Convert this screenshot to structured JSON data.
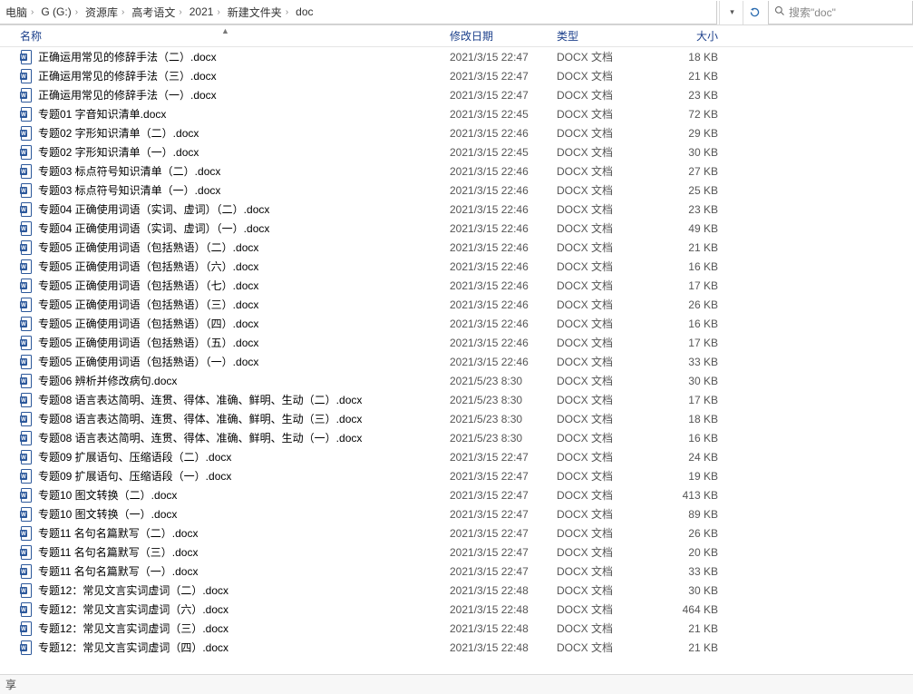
{
  "breadcrumb": {
    "items": [
      "电脑",
      "G (G:)",
      "资源库",
      "高考语文",
      "2021",
      "新建文件夹",
      "doc"
    ]
  },
  "search": {
    "placeholder": "搜索\"doc\""
  },
  "columns": {
    "name": "名称",
    "date": "修改日期",
    "type": "类型",
    "size": "大小"
  },
  "type_label": "DOCX 文档",
  "files": [
    {
      "name": "正确运用常见的修辞手法（二）.docx",
      "date": "2021/3/15 22:47",
      "size": "18 KB"
    },
    {
      "name": "正确运用常见的修辞手法（三）.docx",
      "date": "2021/3/15 22:47",
      "size": "21 KB"
    },
    {
      "name": "正确运用常见的修辞手法（一）.docx",
      "date": "2021/3/15 22:47",
      "size": "23 KB"
    },
    {
      "name": "专题01 字音知识清单.docx",
      "date": "2021/3/15 22:45",
      "size": "72 KB"
    },
    {
      "name": "专题02 字形知识清单（二）.docx",
      "date": "2021/3/15 22:46",
      "size": "29 KB"
    },
    {
      "name": "专题02 字形知识清单（一）.docx",
      "date": "2021/3/15 22:45",
      "size": "30 KB"
    },
    {
      "name": "专题03 标点符号知识清单（二）.docx",
      "date": "2021/3/15 22:46",
      "size": "27 KB"
    },
    {
      "name": "专题03 标点符号知识清单（一）.docx",
      "date": "2021/3/15 22:46",
      "size": "25 KB"
    },
    {
      "name": "专题04 正确使用词语（实词、虚词）（二）.docx",
      "date": "2021/3/15 22:46",
      "size": "23 KB"
    },
    {
      "name": "专题04 正确使用词语（实词、虚词）（一）.docx",
      "date": "2021/3/15 22:46",
      "size": "49 KB"
    },
    {
      "name": "专题05 正确使用词语（包括熟语）（二）.docx",
      "date": "2021/3/15 22:46",
      "size": "21 KB"
    },
    {
      "name": "专题05 正确使用词语（包括熟语）（六）.docx",
      "date": "2021/3/15 22:46",
      "size": "16 KB"
    },
    {
      "name": "专题05 正确使用词语（包括熟语）（七）.docx",
      "date": "2021/3/15 22:46",
      "size": "17 KB"
    },
    {
      "name": "专题05 正确使用词语（包括熟语）（三）.docx",
      "date": "2021/3/15 22:46",
      "size": "26 KB"
    },
    {
      "name": "专题05 正确使用词语（包括熟语）（四）.docx",
      "date": "2021/3/15 22:46",
      "size": "16 KB"
    },
    {
      "name": "专题05 正确使用词语（包括熟语）（五）.docx",
      "date": "2021/3/15 22:46",
      "size": "17 KB"
    },
    {
      "name": "专题05 正确使用词语（包括熟语）（一）.docx",
      "date": "2021/3/15 22:46",
      "size": "33 KB"
    },
    {
      "name": "专题06 辨析并修改病句.docx",
      "date": "2021/5/23 8:30",
      "size": "30 KB"
    },
    {
      "name": "专题08 语言表达简明、连贯、得体、准确、鲜明、生动（二）.docx",
      "date": "2021/5/23 8:30",
      "size": "17 KB"
    },
    {
      "name": "专题08 语言表达简明、连贯、得体、准确、鲜明、生动（三）.docx",
      "date": "2021/5/23 8:30",
      "size": "18 KB"
    },
    {
      "name": "专题08 语言表达简明、连贯、得体、准确、鲜明、生动（一）.docx",
      "date": "2021/5/23 8:30",
      "size": "16 KB"
    },
    {
      "name": "专题09 扩展语句、压缩语段（二）.docx",
      "date": "2021/3/15 22:47",
      "size": "24 KB"
    },
    {
      "name": "专题09 扩展语句、压缩语段（一）.docx",
      "date": "2021/3/15 22:47",
      "size": "19 KB"
    },
    {
      "name": "专题10 图文转换（二）.docx",
      "date": "2021/3/15 22:47",
      "size": "413 KB"
    },
    {
      "name": "专题10 图文转换（一）.docx",
      "date": "2021/3/15 22:47",
      "size": "89 KB"
    },
    {
      "name": "专题11 名句名篇默写（二）.docx",
      "date": "2021/3/15 22:47",
      "size": "26 KB"
    },
    {
      "name": "专题11 名句名篇默写（三）.docx",
      "date": "2021/3/15 22:47",
      "size": "20 KB"
    },
    {
      "name": "专题11 名句名篇默写（一）.docx",
      "date": "2021/3/15 22:47",
      "size": "33 KB"
    },
    {
      "name": "专题12：常见文言实词虚词（二）.docx",
      "date": "2021/3/15 22:48",
      "size": "30 KB"
    },
    {
      "name": "专题12：常见文言实词虚词（六）.docx",
      "date": "2021/3/15 22:48",
      "size": "464 KB"
    },
    {
      "name": "专题12：常见文言实词虚词（三）.docx",
      "date": "2021/3/15 22:48",
      "size": "21 KB"
    },
    {
      "name": "专题12：常见文言实词虚词（四）.docx",
      "date": "2021/3/15 22:48",
      "size": "21 KB"
    }
  ],
  "status": {
    "share": "享"
  }
}
